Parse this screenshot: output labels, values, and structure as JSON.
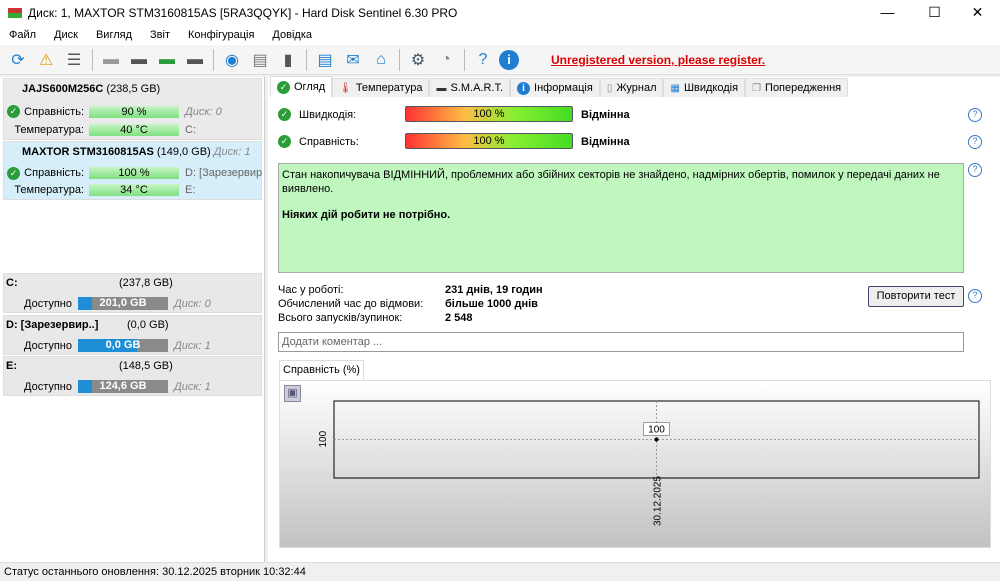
{
  "window": {
    "title": "Диск: 1, MAXTOR STM3160815AS [5RA3QQYK]  -  Hard Disk Sentinel 6.30 PRO",
    "minimize": "—",
    "maximize": "☐",
    "close": "✕"
  },
  "menu": [
    "Файл",
    "Диск",
    "Вигляд",
    "Звіт",
    "Конфігурація",
    "Довідка"
  ],
  "toolbar": {
    "register": "Unregistered version, please register."
  },
  "disks": [
    {
      "name": "JAJS600M256C",
      "size": "(238,5 GB)",
      "health_label": "Справність:",
      "health": "90 %",
      "health_pct": 90,
      "temp_label": "Температура:",
      "temp": "40 °C",
      "disk": "Диск: 0",
      "vol": "C:"
    },
    {
      "name": "MAXTOR STM3160815AS",
      "size": "(149,0 GB)",
      "disk": "Диск: 1",
      "health_label": "Справність:",
      "health": "100 %",
      "health_pct": 100,
      "temp_label": "Температура:",
      "temp": "34 °C",
      "vol1": "D: [Зарезервиро",
      "vol2": "E:"
    }
  ],
  "volumes": [
    {
      "name": "C:",
      "size": "(237,8 GB)",
      "free_label": "Доступно",
      "free": "201,0 GB",
      "used_pct": 15,
      "disk": "Диск: 0"
    },
    {
      "name": "D: [Зарезервир..]",
      "size": "(0,0 GB)",
      "free_label": "Доступно",
      "free": "0,0 GB",
      "used_pct": 100,
      "disk": "Диск: 1"
    },
    {
      "name": "E:",
      "size": "(148,5 GB)",
      "free_label": "Доступно",
      "free": "124,6 GB",
      "used_pct": 16,
      "disk": "Диск: 1"
    }
  ],
  "tabs": [
    "Огляд",
    "Температура",
    "S.M.A.R.T.",
    "Інформація",
    "Журнал",
    "Швидкодія",
    "Попередження"
  ],
  "overview": {
    "speed_label": "Швидкодія:",
    "speed": "100 %",
    "speed_rating": "Відмінна",
    "health_label": "Справність:",
    "health": "100 %",
    "health_rating": "Відмінна",
    "status_text": "Стан накопичувача ВІДМІННИЙ, проблемних або збійних секторів не знайдено, надмірних обертів, помилок у передачі даних не виявлено.",
    "status_action": "Ніяких дій робити не потрібно.",
    "uptime_label": "Час у роботі:",
    "uptime": "231 днів, 19 годин",
    "lifetime_label": "Обчислений час до відмови:",
    "lifetime": "більше 1000 днів",
    "starts_label": "Всього запусків/зупинок:",
    "starts": "2 548",
    "retest": "Повторити тест",
    "comment_placeholder": "Додати коментар ..."
  },
  "chart_data": {
    "type": "line",
    "title": "Справність (%)",
    "x": [
      "30.12.2025"
    ],
    "values": [
      100
    ],
    "yticks": [
      "100"
    ],
    "point_labels": [
      "100"
    ]
  },
  "statusbar": "Статус останнього оновлення: 30.12.2025 вторник 10:32:44"
}
